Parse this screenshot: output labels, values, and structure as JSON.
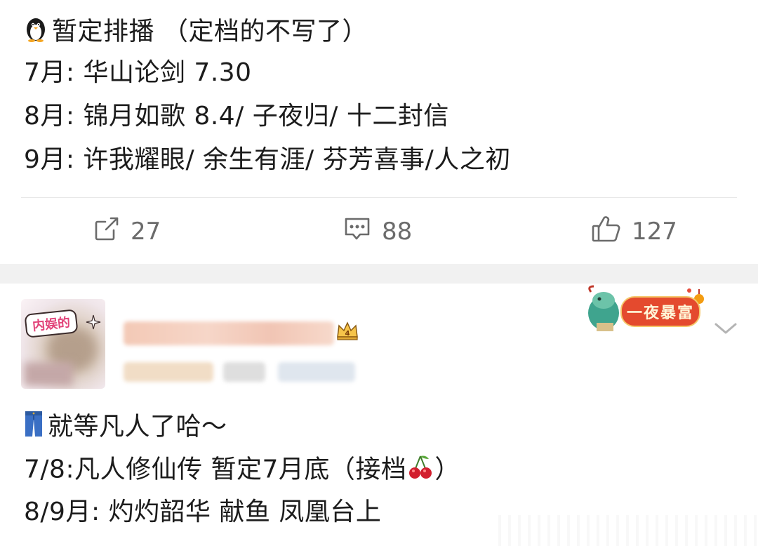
{
  "post1": {
    "lines": [
      "暂定排播 （定档的不写了）",
      "7月: 华山论剑 7.30",
      "8月: 锦月如歌 8.4/ 子夜归/ 十二封信",
      "9月: 许我耀眼/ 余生有涯/ 芬芳喜事/人之初"
    ],
    "first_line_icon": "penguin-icon",
    "actions": {
      "repost_count": "27",
      "comment_count": "88",
      "like_count": "127"
    }
  },
  "post2": {
    "avatar_badge": "内娱的",
    "sticker_text": "一夜暴富",
    "lines": [
      "就等凡人了哈～",
      "7/8:凡人修仙传 暂定7月底（接档",
      "）",
      "8/9月: 灼灼韶华 献鱼 凤凰台上"
    ],
    "first_line_icon": "jeans-icon",
    "inline_emoji": "cherry-icon"
  }
}
